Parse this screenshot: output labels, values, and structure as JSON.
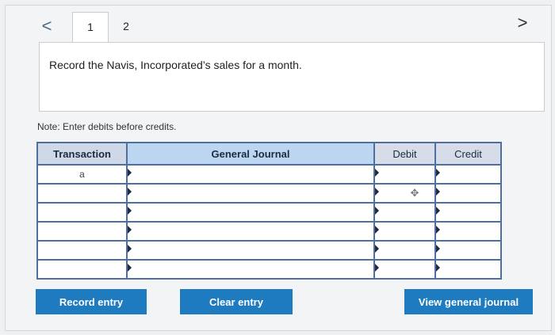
{
  "nav": {
    "prev": "<",
    "next": ">"
  },
  "tabs": [
    {
      "label": "1",
      "active": true
    },
    {
      "label": "2",
      "active": false
    }
  ],
  "question": {
    "text": "Record the Navis, Incorporated’s sales for a month."
  },
  "note": "Note: Enter debits before credits.",
  "journal": {
    "headers": {
      "transaction": "Transaction",
      "general_journal": "General Journal",
      "debit": "Debit",
      "credit": "Credit"
    },
    "rows": [
      {
        "transaction": "a"
      },
      {
        "transaction": ""
      },
      {
        "transaction": ""
      },
      {
        "transaction": ""
      },
      {
        "transaction": ""
      },
      {
        "transaction": ""
      }
    ]
  },
  "buttons": {
    "record": "Record entry",
    "clear": "Clear entry",
    "view": "View general journal"
  },
  "colors": {
    "accent": "#1e7bc0",
    "table_border": "#4f6fa0"
  }
}
